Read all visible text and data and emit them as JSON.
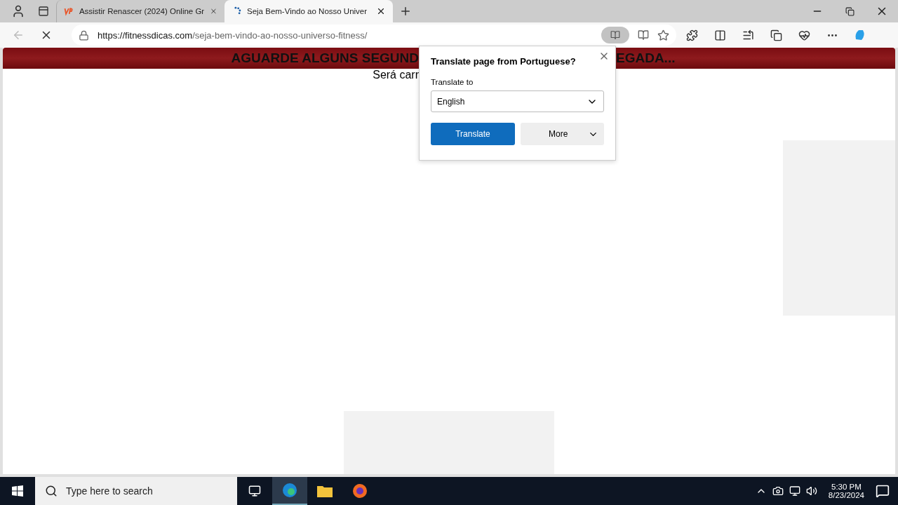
{
  "tabs": [
    {
      "title": "Assistir Renascer (2024) Online Gr",
      "selected": false,
      "kind": "site"
    },
    {
      "title": "Seja Bem-Vindo ao Nosso Univer",
      "selected": true,
      "kind": "loading"
    }
  ],
  "address": {
    "host": "https://fitnessdicas.com",
    "path": "/seja-bem-vindo-ao-nosso-universo-fitness/"
  },
  "page": {
    "banner_left": "AGUARDE ALGUNS SEGUND",
    "banner_right": "EGADA...",
    "subtitle": "Será carr"
  },
  "translate_popup": {
    "title": "Translate page from Portuguese?",
    "label": "Translate to",
    "language": "English",
    "primary_button": "Translate",
    "secondary_button": "More"
  },
  "taskbar": {
    "search_placeholder": "Type here to search",
    "time": "5:30 PM",
    "date": "8/23/2024"
  }
}
